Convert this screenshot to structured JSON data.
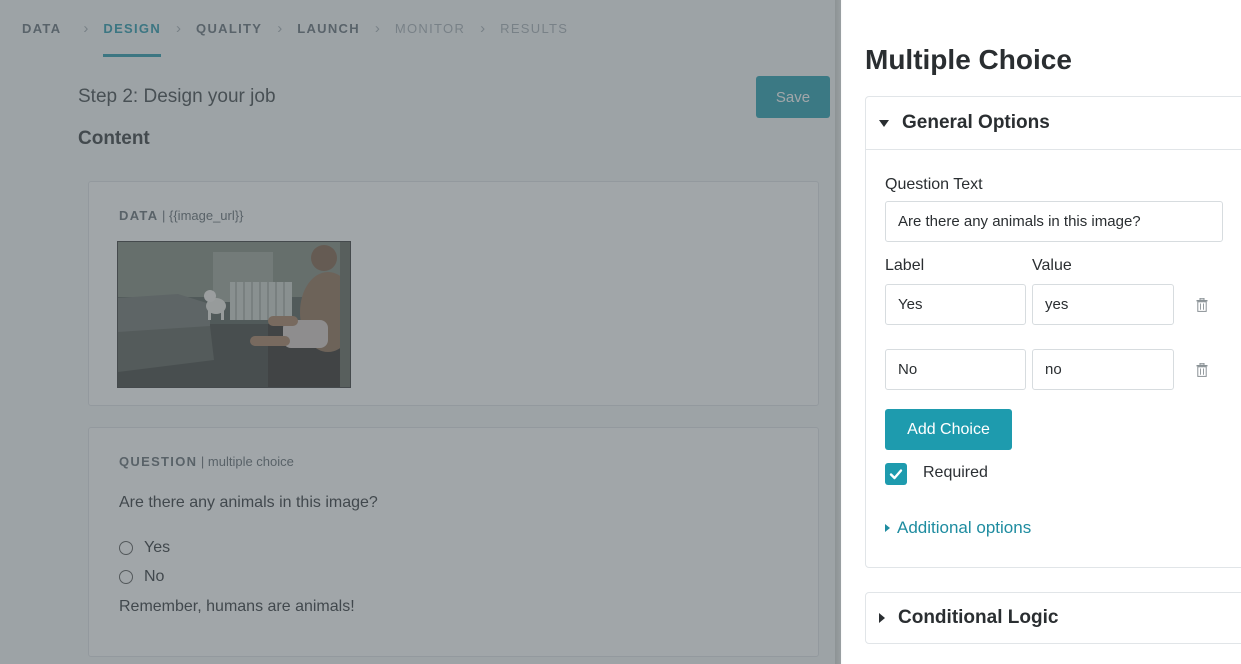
{
  "steps": [
    {
      "label": "DATA",
      "state": "done"
    },
    {
      "label": "DESIGN",
      "state": "active"
    },
    {
      "label": "QUALITY",
      "state": "done"
    },
    {
      "label": "LAUNCH",
      "state": "done"
    },
    {
      "label": "MONITOR",
      "state": "disabled"
    },
    {
      "label": "RESULTS",
      "state": "disabled"
    }
  ],
  "page": {
    "step_title": "Step 2: Design your job",
    "save_label": "Save",
    "content_heading": "Content"
  },
  "data_card": {
    "label_kw": "DATA",
    "label_rest": " | {{image_url}}",
    "image_alt": "man sitting on the floor reaching toward a small white dog in a living room"
  },
  "question_card": {
    "label_kw": "QUESTION",
    "label_rest": " | multiple choice",
    "question": "Are there any animals in this image?",
    "options": [
      "Yes",
      "No"
    ],
    "hint": "Remember, humans are animals!"
  },
  "panel": {
    "title": "Multiple Choice",
    "general_options": "General Options",
    "question_text_label": "Question Text",
    "question_text_value": "Are there any animals in this image?",
    "label_col": "Label",
    "value_col": "Value",
    "choices": [
      {
        "label": "Yes",
        "value": "yes"
      },
      {
        "label": "No",
        "value": "no"
      }
    ],
    "add_choice": "Add Choice",
    "required_label": "Required",
    "required_checked": true,
    "additional_options": "Additional options",
    "conditional_logic": "Conditional Logic"
  },
  "colors": {
    "accent": "#1e9bae",
    "overlay": "#545c63"
  },
  "icons": [
    "chevron-right-icon",
    "caret-down-icon",
    "caret-right-icon",
    "trash-icon",
    "checkmark-icon"
  ]
}
